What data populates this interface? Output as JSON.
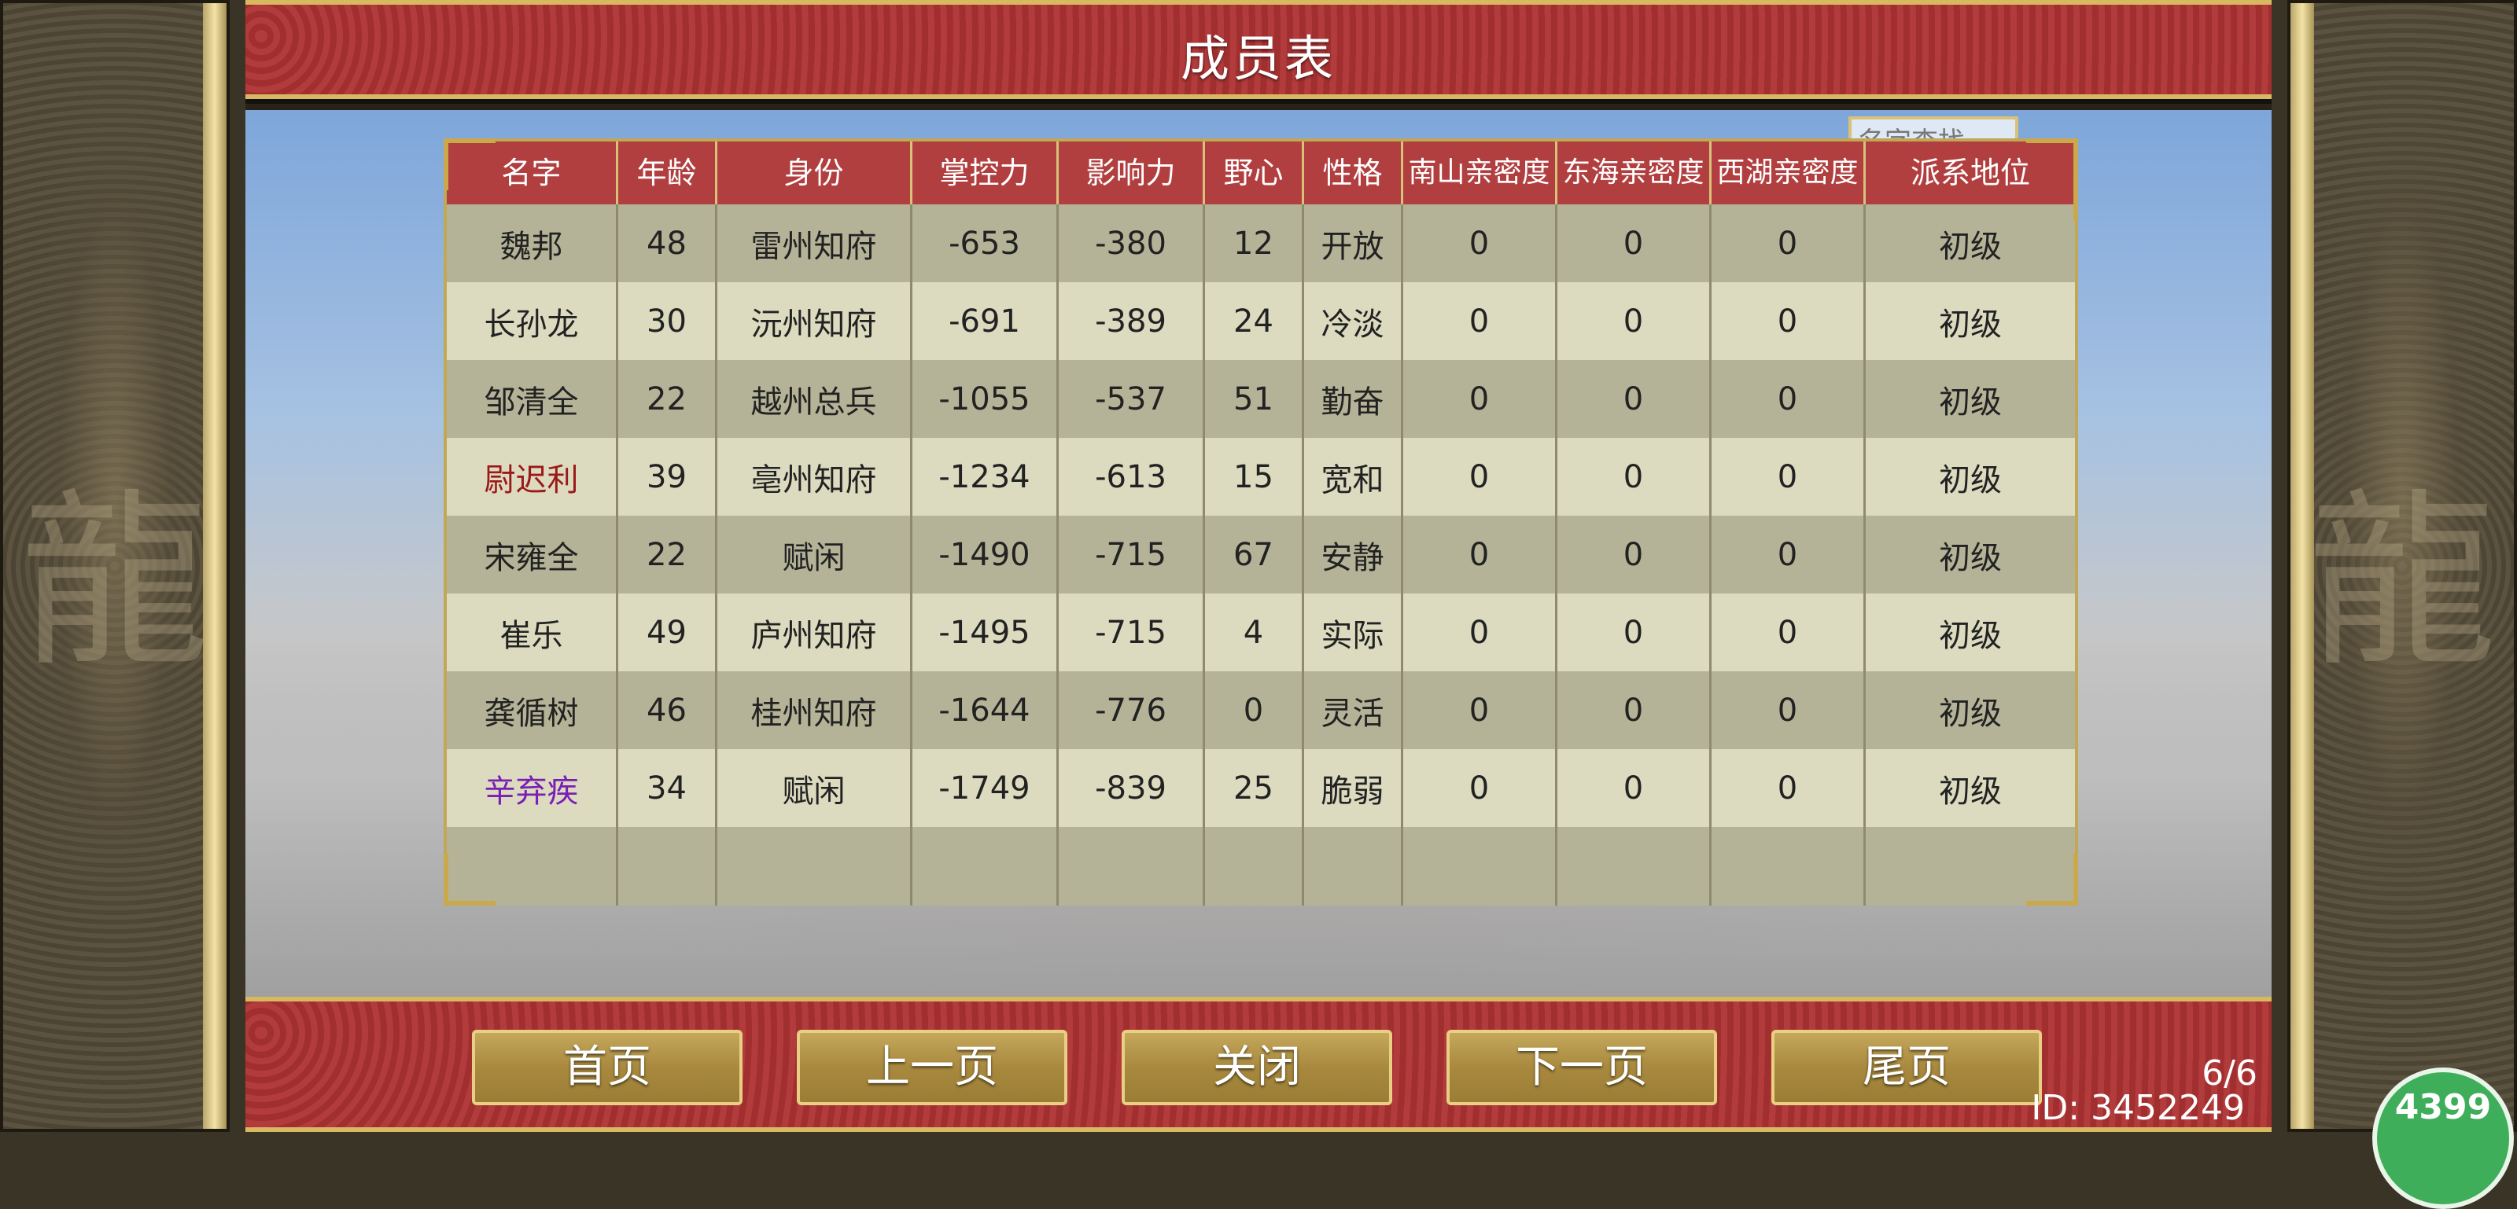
{
  "title": "成员表",
  "search": {
    "placeholder": "名字查找"
  },
  "table": {
    "headers": [
      "名字",
      "年龄",
      "身份",
      "掌控力",
      "影响力",
      "野心",
      "性格",
      "南山亲密度",
      "东海亲密度",
      "西湖亲密度",
      "派系地位"
    ],
    "rows": [
      {
        "name": "魏邦",
        "age": "48",
        "role": "雷州知府",
        "control": "-653",
        "influence": "-380",
        "ambition": "12",
        "trait": "开放",
        "ns": "0",
        "dh": "0",
        "xh": "0",
        "rank": "初级",
        "name_color": "#222222"
      },
      {
        "name": "长孙龙",
        "age": "30",
        "role": "沅州知府",
        "control": "-691",
        "influence": "-389",
        "ambition": "24",
        "trait": "冷淡",
        "ns": "0",
        "dh": "0",
        "xh": "0",
        "rank": "初级",
        "name_color": "#222222"
      },
      {
        "name": "邹清全",
        "age": "22",
        "role": "越州总兵",
        "control": "-1055",
        "influence": "-537",
        "ambition": "51",
        "trait": "勤奋",
        "ns": "0",
        "dh": "0",
        "xh": "0",
        "rank": "初级",
        "name_color": "#222222"
      },
      {
        "name": "尉迟利",
        "age": "39",
        "role": "亳州知府",
        "control": "-1234",
        "influence": "-613",
        "ambition": "15",
        "trait": "宽和",
        "ns": "0",
        "dh": "0",
        "xh": "0",
        "rank": "初级",
        "name_color": "#9a1a1a"
      },
      {
        "name": "宋雍全",
        "age": "22",
        "role": "赋闲",
        "control": "-1490",
        "influence": "-715",
        "ambition": "67",
        "trait": "安静",
        "ns": "0",
        "dh": "0",
        "xh": "0",
        "rank": "初级",
        "name_color": "#222222"
      },
      {
        "name": "崔乐",
        "age": "49",
        "role": "庐州知府",
        "control": "-1495",
        "influence": "-715",
        "ambition": "4",
        "trait": "实际",
        "ns": "0",
        "dh": "0",
        "xh": "0",
        "rank": "初级",
        "name_color": "#222222"
      },
      {
        "name": "龚循树",
        "age": "46",
        "role": "桂州知府",
        "control": "-1644",
        "influence": "-776",
        "ambition": "0",
        "trait": "灵活",
        "ns": "0",
        "dh": "0",
        "xh": "0",
        "rank": "初级",
        "name_color": "#222222"
      },
      {
        "name": "辛弃疾",
        "age": "34",
        "role": "赋闲",
        "control": "-1749",
        "influence": "-839",
        "ambition": "25",
        "trait": "脆弱",
        "ns": "0",
        "dh": "0",
        "xh": "0",
        "rank": "初级",
        "name_color": "#7a1fb5"
      }
    ]
  },
  "buttons": {
    "first": "首页",
    "prev": "上一页",
    "close": "关闭",
    "next": "下一页",
    "last": "尾页"
  },
  "page_indicator": "6/6",
  "user_id": "ID: 3452249",
  "badge": "4399",
  "colors": {
    "header_red": "#b23f40",
    "row_dark": "#b5b397",
    "row_light": "#dcdbc0",
    "gold": "#d8c27a"
  }
}
